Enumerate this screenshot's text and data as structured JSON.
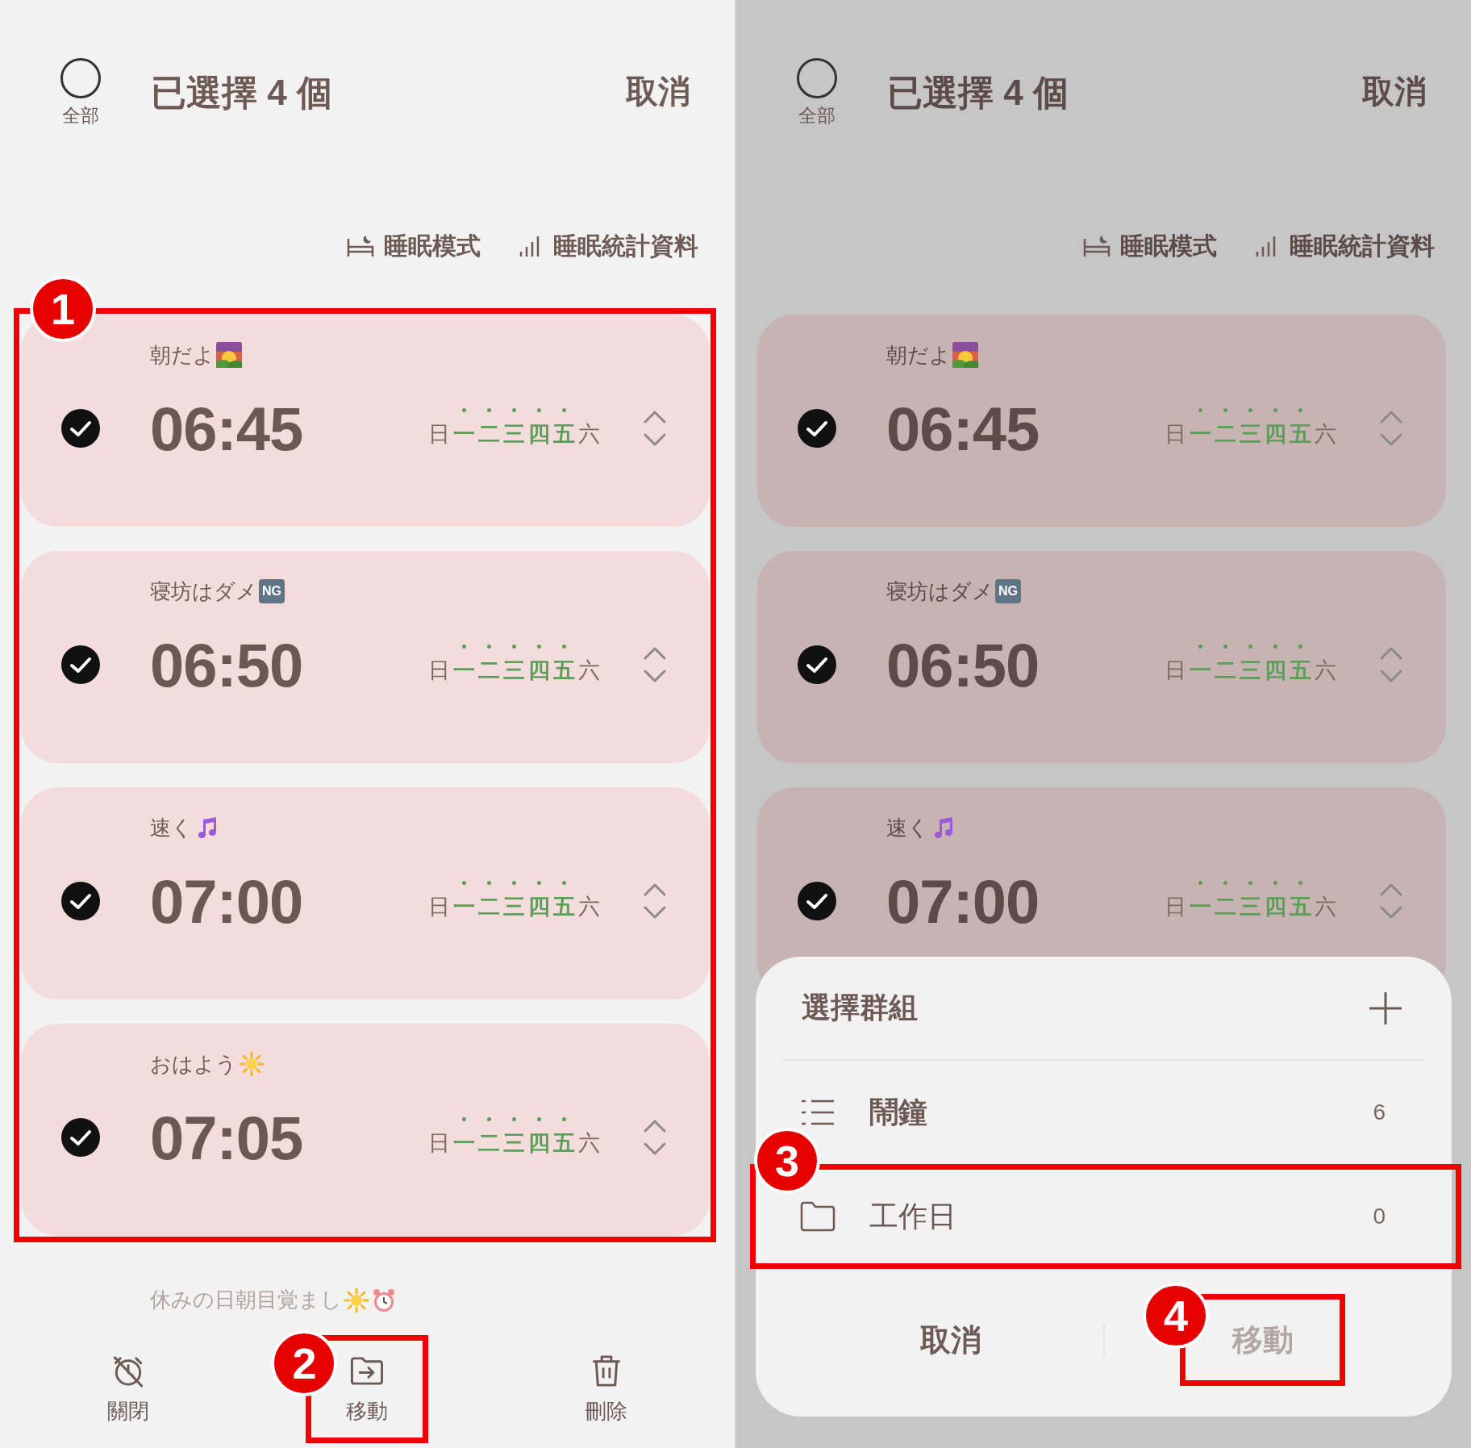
{
  "screens": [
    {
      "dimmed": false,
      "header": {
        "select_all_label": "全部",
        "title": "已選擇 4 個",
        "cancel": "取消"
      },
      "links": [
        {
          "kind": "sleep_mode",
          "label": "睡眠模式"
        },
        {
          "kind": "sleep_stats",
          "label": "睡眠統計資料"
        }
      ],
      "alarms_annotation": "1",
      "alarms": [
        {
          "label": "朝だよ",
          "emoji": [
            {
              "kind": "sunrise"
            }
          ],
          "time": "06:45",
          "checked": true,
          "days": [
            {
              "label": "日",
              "active": false
            },
            {
              "label": "一",
              "active": true
            },
            {
              "label": "二",
              "active": true
            },
            {
              "label": "三",
              "active": true
            },
            {
              "label": "四",
              "active": true
            },
            {
              "label": "五",
              "active": true
            },
            {
              "label": "六",
              "active": false
            }
          ]
        },
        {
          "label": "寝坊はダメ",
          "emoji": [
            {
              "kind": "ng",
              "text": "NG"
            }
          ],
          "time": "06:50",
          "checked": true,
          "days": [
            {
              "label": "日",
              "active": false
            },
            {
              "label": "一",
              "active": true
            },
            {
              "label": "二",
              "active": true
            },
            {
              "label": "三",
              "active": true
            },
            {
              "label": "四",
              "active": true
            },
            {
              "label": "五",
              "active": true
            },
            {
              "label": "六",
              "active": false
            }
          ]
        },
        {
          "label": "速く",
          "emoji": [
            {
              "kind": "music"
            }
          ],
          "time": "07:00",
          "checked": true,
          "days": [
            {
              "label": "日",
              "active": false
            },
            {
              "label": "一",
              "active": true
            },
            {
              "label": "二",
              "active": true
            },
            {
              "label": "三",
              "active": true
            },
            {
              "label": "四",
              "active": true
            },
            {
              "label": "五",
              "active": true
            },
            {
              "label": "六",
              "active": false
            }
          ]
        },
        {
          "label": "おはよう",
          "emoji": [
            {
              "kind": "sun"
            }
          ],
          "time": "07:05",
          "checked": true,
          "days": [
            {
              "label": "日",
              "active": false
            },
            {
              "label": "一",
              "active": true
            },
            {
              "label": "二",
              "active": true
            },
            {
              "label": "三",
              "active": true
            },
            {
              "label": "四",
              "active": true
            },
            {
              "label": "五",
              "active": true
            },
            {
              "label": "六",
              "active": false
            }
          ]
        }
      ],
      "next_label": {
        "label": "休みの日朝目覚まし",
        "emoji": [
          {
            "kind": "sun"
          },
          {
            "kind": "alarm_clock"
          }
        ]
      },
      "bottom_bar": [
        {
          "kind": "off",
          "label": "關閉"
        },
        {
          "kind": "move",
          "label": "移動",
          "annotation": "2"
        },
        {
          "kind": "delete",
          "label": "刪除"
        }
      ]
    },
    {
      "dimmed": true,
      "header": {
        "select_all_label": "全部",
        "title": "已選擇 4 個",
        "cancel": "取消"
      },
      "links": [
        {
          "kind": "sleep_mode",
          "label": "睡眠模式"
        },
        {
          "kind": "sleep_stats",
          "label": "睡眠統計資料"
        }
      ],
      "alarms": [
        {
          "label": "朝だよ",
          "emoji": [
            {
              "kind": "sunrise"
            }
          ],
          "time": "06:45",
          "checked": true,
          "days": [
            {
              "label": "日",
              "active": false
            },
            {
              "label": "一",
              "active": true
            },
            {
              "label": "二",
              "active": true
            },
            {
              "label": "三",
              "active": true
            },
            {
              "label": "四",
              "active": true
            },
            {
              "label": "五",
              "active": true
            },
            {
              "label": "六",
              "active": false
            }
          ]
        },
        {
          "label": "寝坊はダメ",
          "emoji": [
            {
              "kind": "ng",
              "text": "NG"
            }
          ],
          "time": "06:50",
          "checked": true,
          "days": [
            {
              "label": "日",
              "active": false
            },
            {
              "label": "一",
              "active": true
            },
            {
              "label": "二",
              "active": true
            },
            {
              "label": "三",
              "active": true
            },
            {
              "label": "四",
              "active": true
            },
            {
              "label": "五",
              "active": true
            },
            {
              "label": "六",
              "active": false
            }
          ]
        },
        {
          "label": "速く",
          "emoji": [
            {
              "kind": "music"
            }
          ],
          "time": "07:00",
          "checked": true,
          "days": [
            {
              "label": "日",
              "active": false
            },
            {
              "label": "一",
              "active": true
            },
            {
              "label": "二",
              "active": true
            },
            {
              "label": "三",
              "active": true
            },
            {
              "label": "四",
              "active": true
            },
            {
              "label": "五",
              "active": true
            },
            {
              "label": "六",
              "active": false
            }
          ]
        }
      ],
      "sheet": {
        "title": "選擇群組",
        "groups": [
          {
            "kind": "list",
            "name": "鬧鐘",
            "count": "6",
            "current": true
          },
          {
            "kind": "folder",
            "name": "工作日",
            "count": "0",
            "current": false,
            "annotation": "3"
          }
        ],
        "buttons": [
          {
            "label": "取消",
            "disabled": false
          },
          {
            "label": "移動",
            "disabled": true,
            "annotation": "4"
          }
        ]
      }
    }
  ]
}
